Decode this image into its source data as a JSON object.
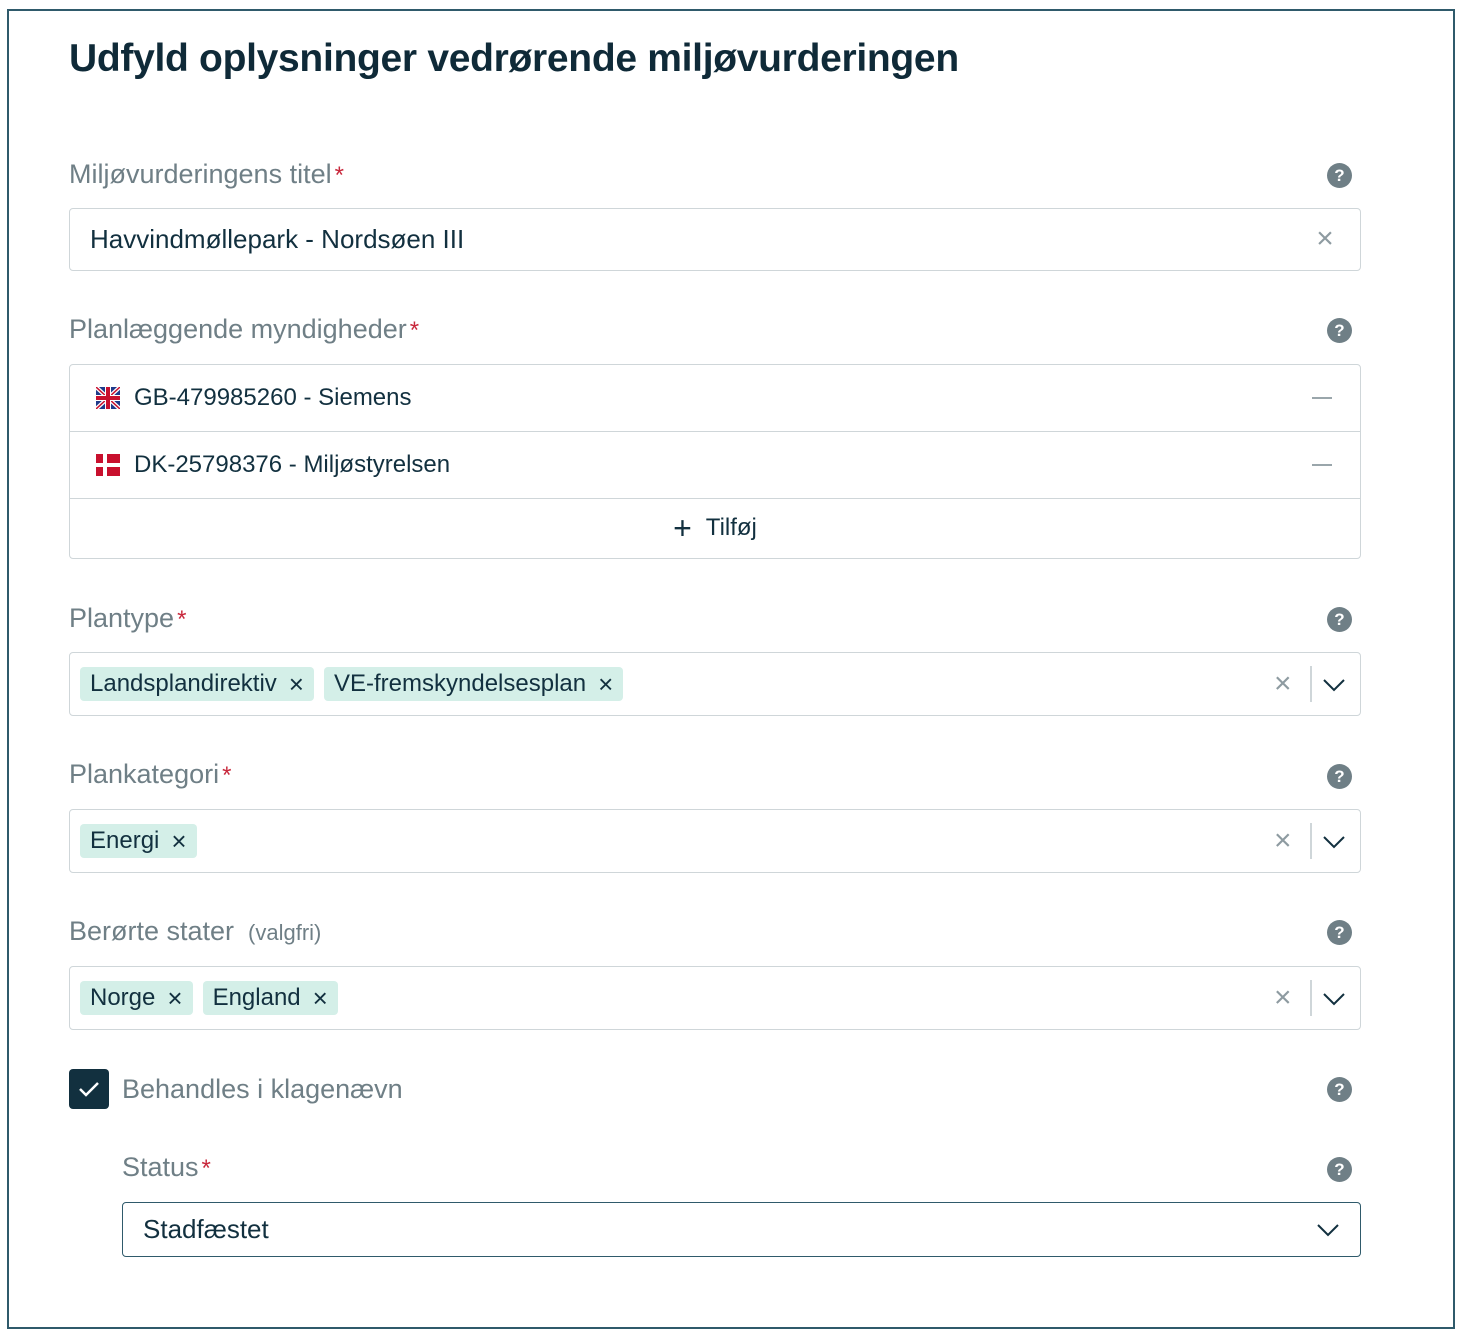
{
  "page_title": "Udfyld oplysninger vedrørende miljøvurderingen",
  "fields": {
    "title": {
      "label": "Miljøvurderingens titel",
      "required": "*",
      "value": "Havvindmøllepark - Nordsøen III",
      "clear_icon": "close-icon",
      "help": "?"
    },
    "authorities": {
      "label": "Planlæggende myndigheder",
      "required": "*",
      "help": "?",
      "items": [
        {
          "flag": "uk-flag-icon",
          "text": "GB-479985260 - Siemens"
        },
        {
          "flag": "dk-flag-icon",
          "text": "DK-25798376 - Miljøstyrelsen"
        }
      ],
      "add_label": "Tilføj",
      "add_icon": "+"
    },
    "plan_type": {
      "label": "Plantype",
      "required": "*",
      "help": "?",
      "tags": [
        "Landsplandirektiv",
        "VE-fremskyndelsesplan"
      ]
    },
    "plan_category": {
      "label": "Plankategori",
      "required": "*",
      "help": "?",
      "tags": [
        "Energi"
      ]
    },
    "affected_states": {
      "label": "Berørte stater",
      "optional": "(valgfri)",
      "help": "?",
      "tags": [
        "Norge",
        "England"
      ]
    },
    "appeal": {
      "label": "Behandles i klagenævn",
      "checked": true,
      "help": "?"
    },
    "status": {
      "label": "Status",
      "required": "*",
      "help": "?",
      "value": "Stadfæstet"
    }
  },
  "icons": {
    "tag_remove": "×",
    "clear": "×"
  },
  "colors": {
    "primary": "#12303f",
    "tag_bg": "#d4efe8",
    "required": "#c8283c",
    "label": "#6f7f86",
    "border": "#cfd6d9"
  }
}
